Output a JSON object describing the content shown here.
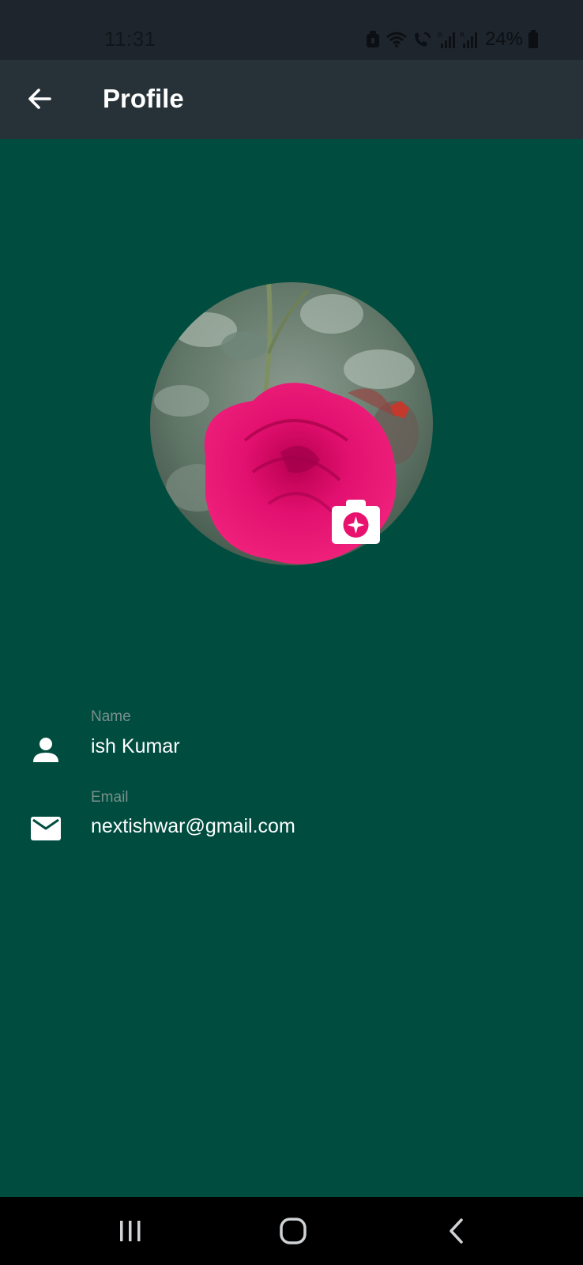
{
  "status_bar": {
    "time": "11:31",
    "battery": "24%",
    "icons": [
      "alarm-icon",
      "wifi-icon",
      "wifi-calling-icon",
      "signal-icon",
      "signal-icon",
      "battery-icon"
    ]
  },
  "app_bar": {
    "title": "Profile",
    "back_icon": "arrow-left-icon"
  },
  "profile": {
    "avatar": "rose-photo",
    "camera_icon": "camera-icon"
  },
  "fields": {
    "name": {
      "label": "Name",
      "value": "ish Kumar",
      "icon": "person-icon"
    },
    "email": {
      "label": "Email",
      "value": "nextishwar@gmail.com",
      "icon": "mail-icon"
    }
  },
  "nav_bar": {
    "recents_icon": "recents-icon",
    "home_icon": "home-icon",
    "back_icon": "back-chevron-icon"
  },
  "colors": {
    "background": "#004d40",
    "app_bar": "#263238",
    "status_bar": "#1f252c",
    "accent_pink": "#e8126e"
  }
}
